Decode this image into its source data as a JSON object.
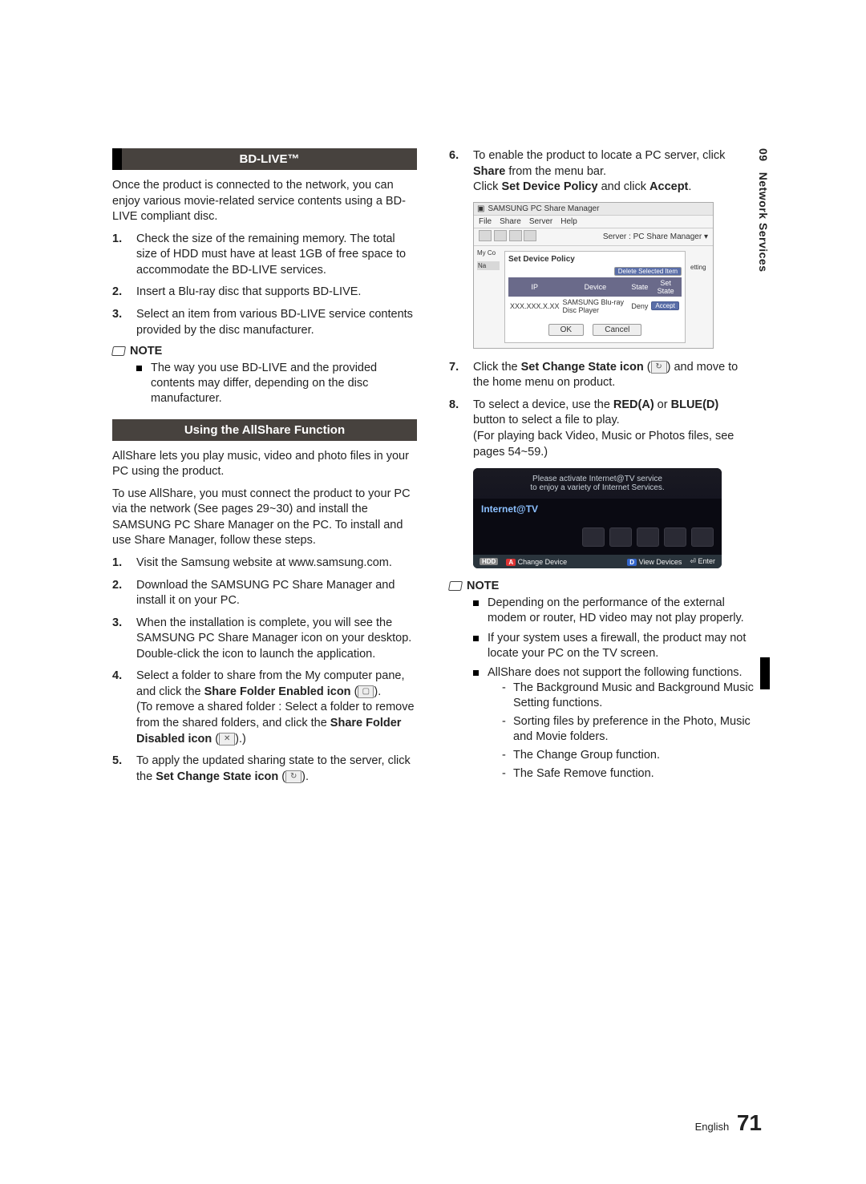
{
  "sidebar": {
    "chapter_num": "09",
    "chapter_title": "Network Services"
  },
  "footer": {
    "lang": "English",
    "page": "71"
  },
  "left": {
    "bdlive": {
      "title": "BD-LIVE™",
      "intro": "Once the product is connected to the network, you can enjoy various movie-related service contents using a BD-LIVE compliant disc.",
      "steps": [
        "Check the size of the remaining memory. The total size of HDD must have at least 1GB of free space to accommodate the BD-LIVE services.",
        "Insert a Blu-ray disc that supports BD-LIVE.",
        "Select an item from various BD-LIVE service contents provided by the disc manufacturer."
      ],
      "note_label": "NOTE",
      "notes": [
        "The way you use BD-LIVE and the provided contents may differ, depending on the disc manufacturer."
      ]
    },
    "allshare": {
      "title": "Using the AllShare Function",
      "p1": "AllShare lets you play music, video and photo files in your PC using the product.",
      "p2": "To use AllShare, you must connect the product to your PC via the network (See pages 29~30) and install the SAMSUNG PC Share Manager on the PC. To install and use Share Manager, follow these steps.",
      "steps": {
        "s1": "Visit the Samsung website at www.samsung.com.",
        "s2": "Download the SAMSUNG PC Share Manager and install it on your PC.",
        "s3a": "When the installation is complete, you will see the SAMSUNG PC Share Manager icon on your desktop.",
        "s3b": "Double-click the icon to launch the application.",
        "s4a_pre": "Select a folder to share from the My computer pane, and click the ",
        "s4a_bold": "Share Folder Enabled icon",
        "s4a_post": " (",
        "s4b": "(To remove a shared folder : Select a folder to remove from the shared folders, and click the ",
        "s4b_bold": "Share Folder Disabled icon",
        "s4b_post": " (",
        "s5_pre": "To apply the updated sharing state to the server, click the ",
        "s5_bold": "Set Change State icon",
        "s5_post": " ("
      }
    }
  },
  "right": {
    "steps": {
      "s6a_pre": "To enable the product to locate a PC server, click ",
      "s6a_b1": "Share",
      "s6a_mid": " from the menu bar.",
      "s6b_pre": "Click ",
      "s6b_b1": "Set Device Policy",
      "s6b_mid": " and click ",
      "s6b_b2": "Accept",
      "s6b_post": ".",
      "s7_pre": "Click the ",
      "s7_b": "Set Change State icon",
      "s7_mid": " (",
      "s7_post": ") and move to the home menu on product.",
      "s8_pre": "To select a device, use the ",
      "s8_b1": "RED(A)",
      "s8_or": " or ",
      "s8_b2": "BLUE(D)",
      "s8_mid": " button to select a file to play.",
      "s8_sub": "(For playing back Video, Music or Photos files, see pages 54~59.)"
    },
    "ss": {
      "window_title": "SAMSUNG PC Share Manager",
      "menu": [
        "File",
        "Share",
        "Server",
        "Help"
      ],
      "server_label": "Server : PC Share Manager ▾",
      "dialog_title": "Set Device Policy",
      "del_btn": "Delete Selected Item",
      "cols": [
        "IP",
        "Device",
        "State",
        "Set State"
      ],
      "row": {
        "ip": "XXX.XXX.X.XX",
        "device": "SAMSUNG Blu-ray Disc Player",
        "state": "Deny",
        "btn": "Accept"
      },
      "ok": "OK",
      "cancel": "Cancel",
      "sidebar_label": "My Co",
      "sidebar_na": "Na",
      "setting_cut": "etting"
    },
    "tv": {
      "msg1": "Please activate Internet@TV service",
      "msg2": "to enjoy a variety of Internet Services.",
      "brand": "Internet@TV",
      "hdd": "HDD",
      "a_label": "Change Device",
      "d_label": "View Devices",
      "enter": "Enter",
      "badge_a": "A",
      "badge_d": "D",
      "enter_icon": "⏎"
    },
    "note_label": "NOTE",
    "notes": {
      "n1": "Depending on the performance of the external modem or router, HD video may not play properly.",
      "n2": "If your system uses a firewall, the product may not locate your PC on the TV screen.",
      "n3": "AllShare does not support the following functions.",
      "sub": [
        "The Background Music and Background Music Setting functions.",
        "Sorting files by preference in the Photo, Music and Movie folders.",
        "The Change Group function.",
        "The Safe Remove function."
      ]
    }
  }
}
